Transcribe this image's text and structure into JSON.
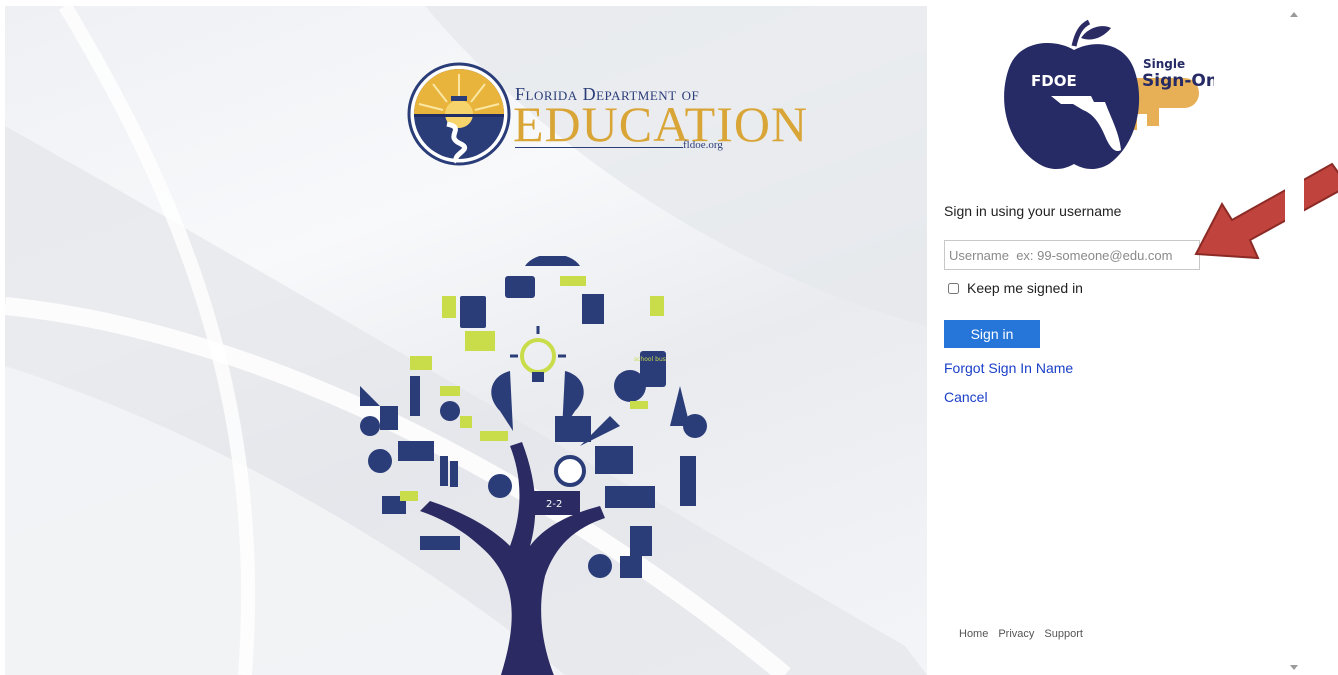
{
  "branding": {
    "dept_line1": "Florida Department of",
    "dept_line2": "EDUCATION",
    "site": "fldoe.org",
    "sso_badge_abbrev": "FDOE",
    "sso_badge_single": "Single",
    "sso_badge_signon": "Sign-On"
  },
  "tree_art": {
    "sign_text": "2-2",
    "bus_sign_text": "school bus"
  },
  "signin": {
    "heading": "Sign in using your username",
    "username_placeholder": "Username  ex: 99-someone@edu.com",
    "username_value": "",
    "keep_signed_in_label": "Keep me signed in",
    "keep_signed_in_checked": false,
    "signin_button": "Sign in",
    "forgot_link": "Forgot Sign In Name",
    "cancel_link": "Cancel"
  },
  "footer": {
    "links": [
      "Home",
      "Privacy",
      "Support"
    ]
  },
  "colors": {
    "navy": "#2b3d79",
    "gold": "#d9a536",
    "button_blue": "#2675d9",
    "link_blue": "#1a3fc8",
    "arrow_red": "#c0443d",
    "tree_lime": "#c9dc4a"
  },
  "icons": {
    "annotation": "red-arrow-icon",
    "scroll_up": "scroll-up-icon",
    "scroll_down": "scroll-down-icon"
  }
}
